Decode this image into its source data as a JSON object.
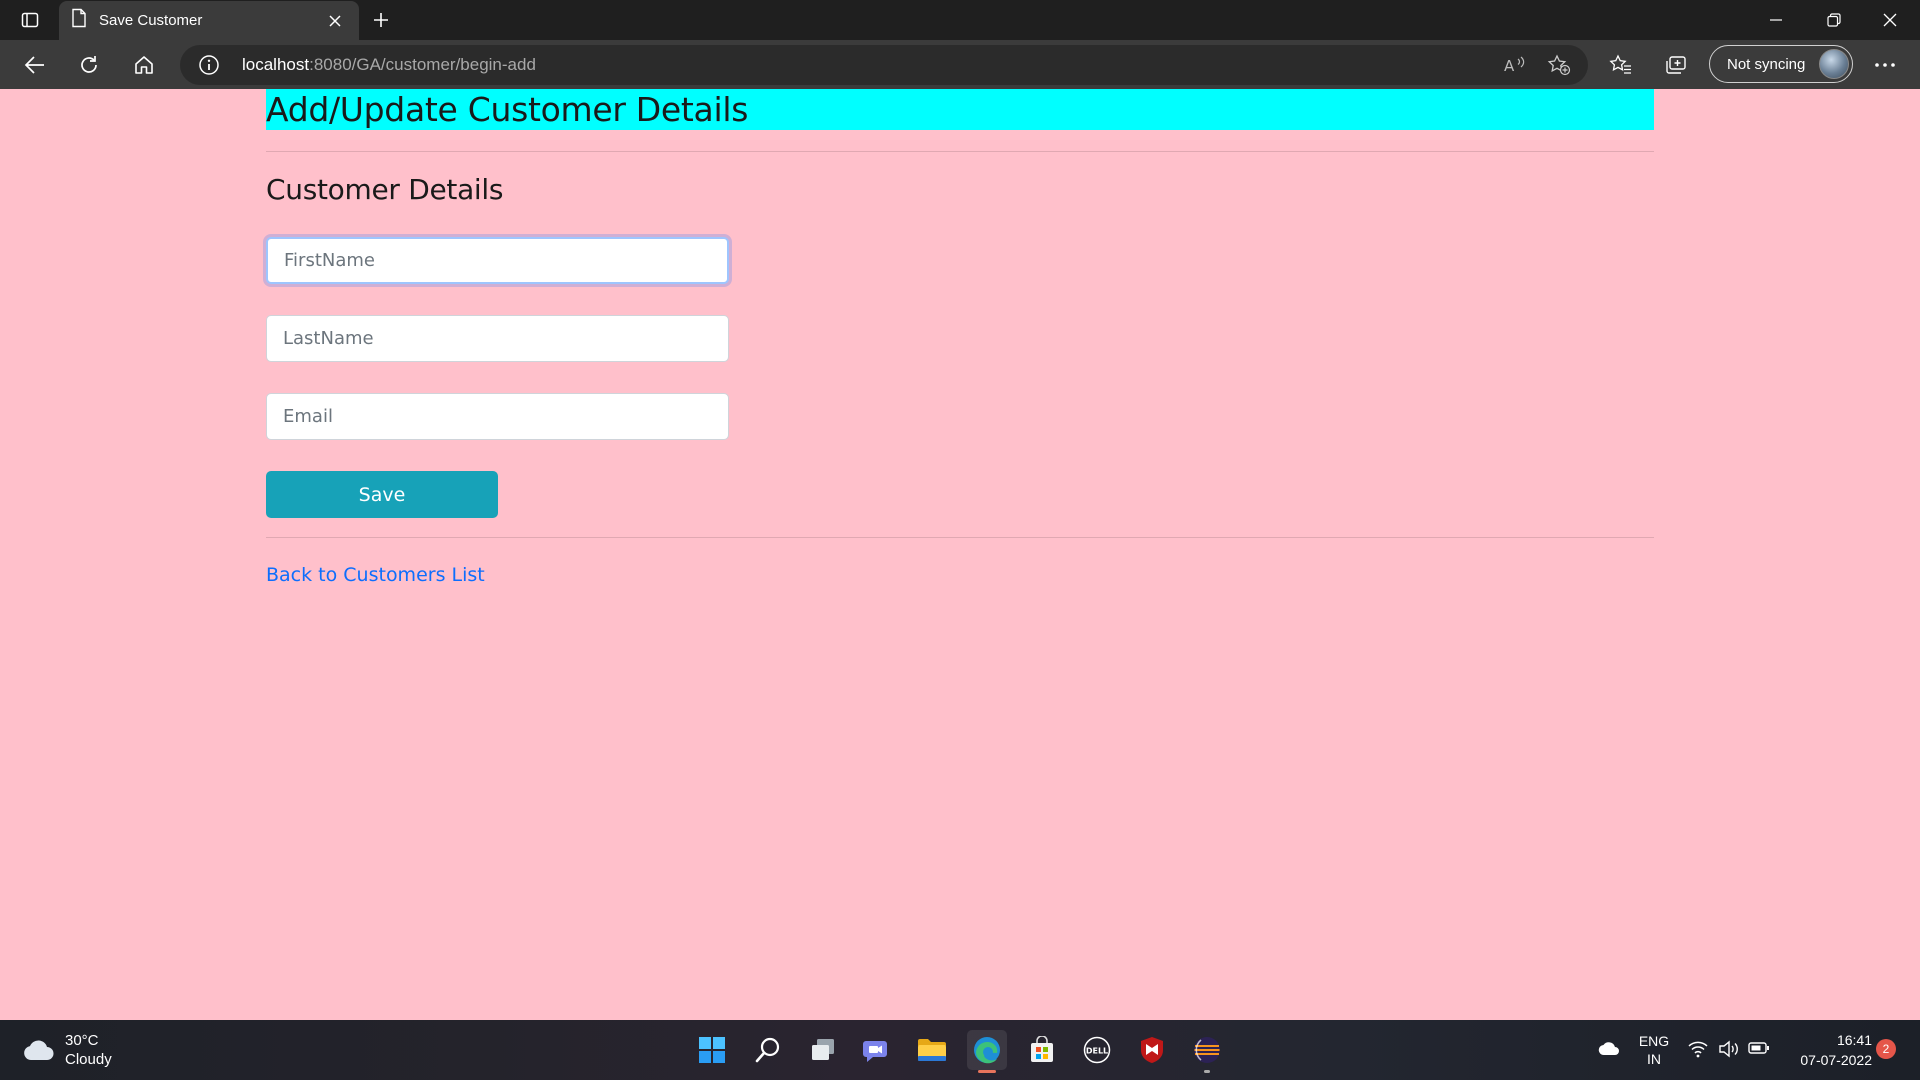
{
  "browser": {
    "tab_title": "Save Customer",
    "url_host": "localhost",
    "url_rest": ":8080/GA/customer/begin-add",
    "sync_label": "Not syncing"
  },
  "page": {
    "heading": "Add/Update Customer Details",
    "section_title": "Customer Details",
    "fields": {
      "first_name_placeholder": "FirstName",
      "last_name_placeholder": "LastName",
      "email_placeholder": "Email"
    },
    "save_label": "Save",
    "back_link": "Back to Customers List"
  },
  "colors": {
    "page_background": "#ffc0cb",
    "banner": "#00ffff",
    "save_button": "#17a2b8",
    "link": "#0d6efd"
  },
  "taskbar": {
    "weather_temp": "30°C",
    "weather_condition": "Cloudy",
    "language_top": "ENG",
    "language_bottom": "IN",
    "time": "16:41",
    "date": "07-07-2022",
    "notification_count": "2",
    "icons": [
      "start-icon",
      "search-icon",
      "task-view-icon",
      "teams-chat-icon",
      "file-explorer-icon",
      "edge-icon",
      "store-icon",
      "dell-icon",
      "mcafee-icon",
      "eclipse-icon"
    ]
  }
}
